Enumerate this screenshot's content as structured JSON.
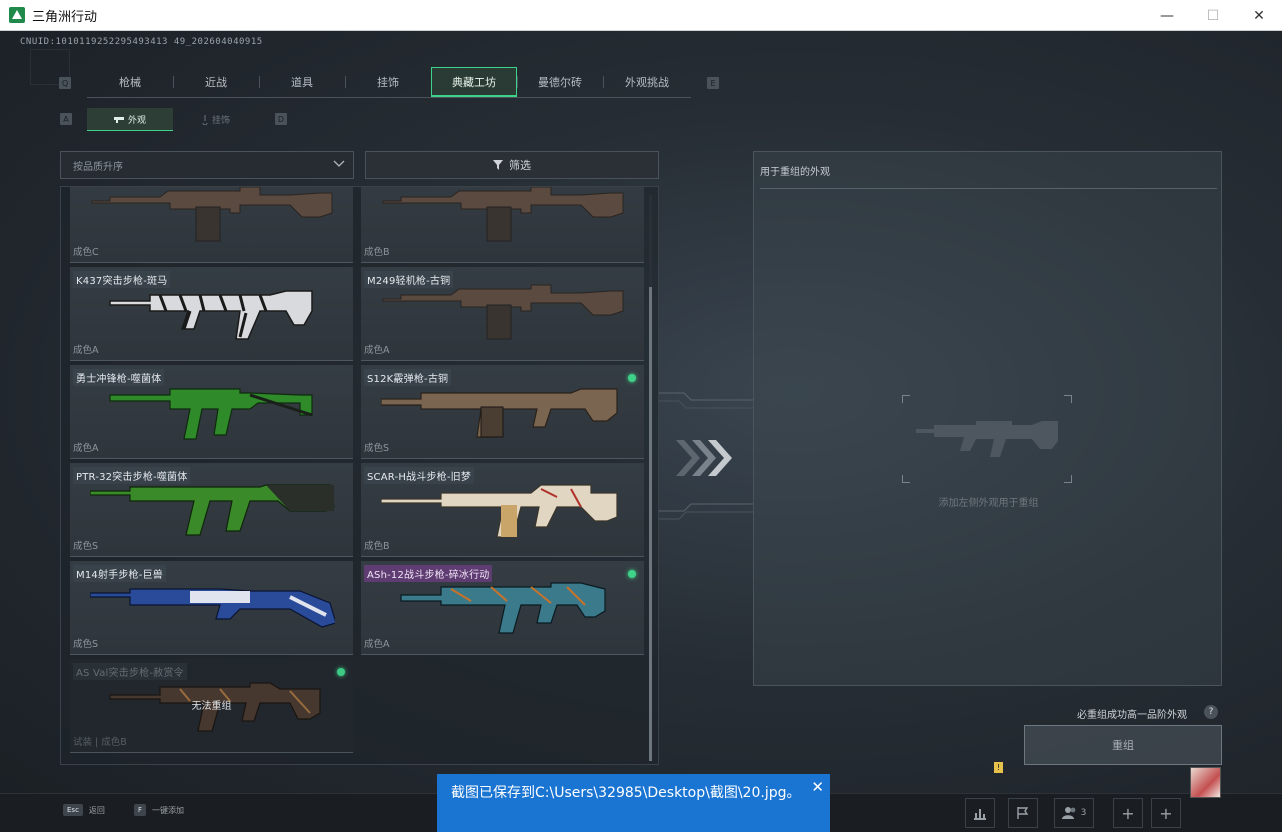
{
  "window": {
    "title": "三角洲行动",
    "minimize": "—",
    "maximize": "☐",
    "close": "✕"
  },
  "uid": "CNUID:1010119252295493413 49_202604040915",
  "top_tabs": {
    "left_key": "Q",
    "right_key": "E",
    "items": [
      {
        "label": "枪械"
      },
      {
        "label": "近战"
      },
      {
        "label": "道具"
      },
      {
        "label": "挂饰"
      },
      {
        "label": "典藏工坊"
      },
      {
        "label": "曼德尔砖"
      },
      {
        "label": "外观挑战"
      }
    ],
    "active_index": 4
  },
  "sub_tabs": {
    "left_key": "A",
    "right_key": "D",
    "items": [
      {
        "label": "外观"
      },
      {
        "label": "挂饰"
      }
    ],
    "active_index": 0
  },
  "sort": {
    "value": "按品质升序"
  },
  "filter": {
    "label": "筛选"
  },
  "cards": [
    {
      "name": "",
      "quality": "成色C",
      "has_dot": false,
      "gun": "lmg-dark"
    },
    {
      "name": "",
      "quality": "成色B",
      "has_dot": false,
      "gun": "lmg-dark"
    },
    {
      "name": "K437突击步枪-斑马",
      "quality": "成色A",
      "has_dot": false,
      "gun": "rifle-zebra"
    },
    {
      "name": "M249轻机枪-古铜",
      "quality": "成色A",
      "has_dot": false,
      "gun": "lmg-dark"
    },
    {
      "name": "勇士冲锋枪-噬菌体",
      "quality": "成色A",
      "has_dot": false,
      "gun": "smg-green"
    },
    {
      "name": "S12K霰弹枪-古铜",
      "quality": "成色S",
      "has_dot": true,
      "gun": "shotgun-bronze"
    },
    {
      "name": "PTR-32突击步枪-噬菌体",
      "quality": "成色S",
      "has_dot": false,
      "gun": "rifle-green"
    },
    {
      "name": "SCAR-H战斗步枪-旧梦",
      "quality": "成色B",
      "has_dot": false,
      "gun": "scar-cream"
    },
    {
      "name": "M14射手步枪-巨兽",
      "quality": "成色S",
      "has_dot": false,
      "gun": "m14-blue"
    },
    {
      "name": "ASh-12战斗步枪-碎冰行动",
      "quality": "成色A",
      "has_dot": true,
      "gun": "ash-teal",
      "purple": true
    },
    {
      "name": "AS Val突击步枪-赦赏令",
      "quality": "试装 | 成色B",
      "has_dot": true,
      "gun": "asval-dark",
      "disabled": true,
      "locked_text": "无法重组"
    }
  ],
  "right_panel": {
    "title": "用于重组的外观",
    "slot_hint": "添加左侧外观用于重组"
  },
  "upgrade_note": "必重组成功高一品阶外观",
  "help": "?",
  "recombine_button": "重组",
  "bottom": {
    "esc_key": "Esc",
    "esc_label": "返回",
    "f_key": "F",
    "f_label": "一键添加",
    "friends_count": "3",
    "notif": "!"
  },
  "toast": {
    "text": "截图已保存到C:\\Users\\32985\\Desktop\\截图\\20.jpg。",
    "close": "✕"
  },
  "colors": {
    "accent": "#3fd38a",
    "toast": "#1a74d2"
  }
}
